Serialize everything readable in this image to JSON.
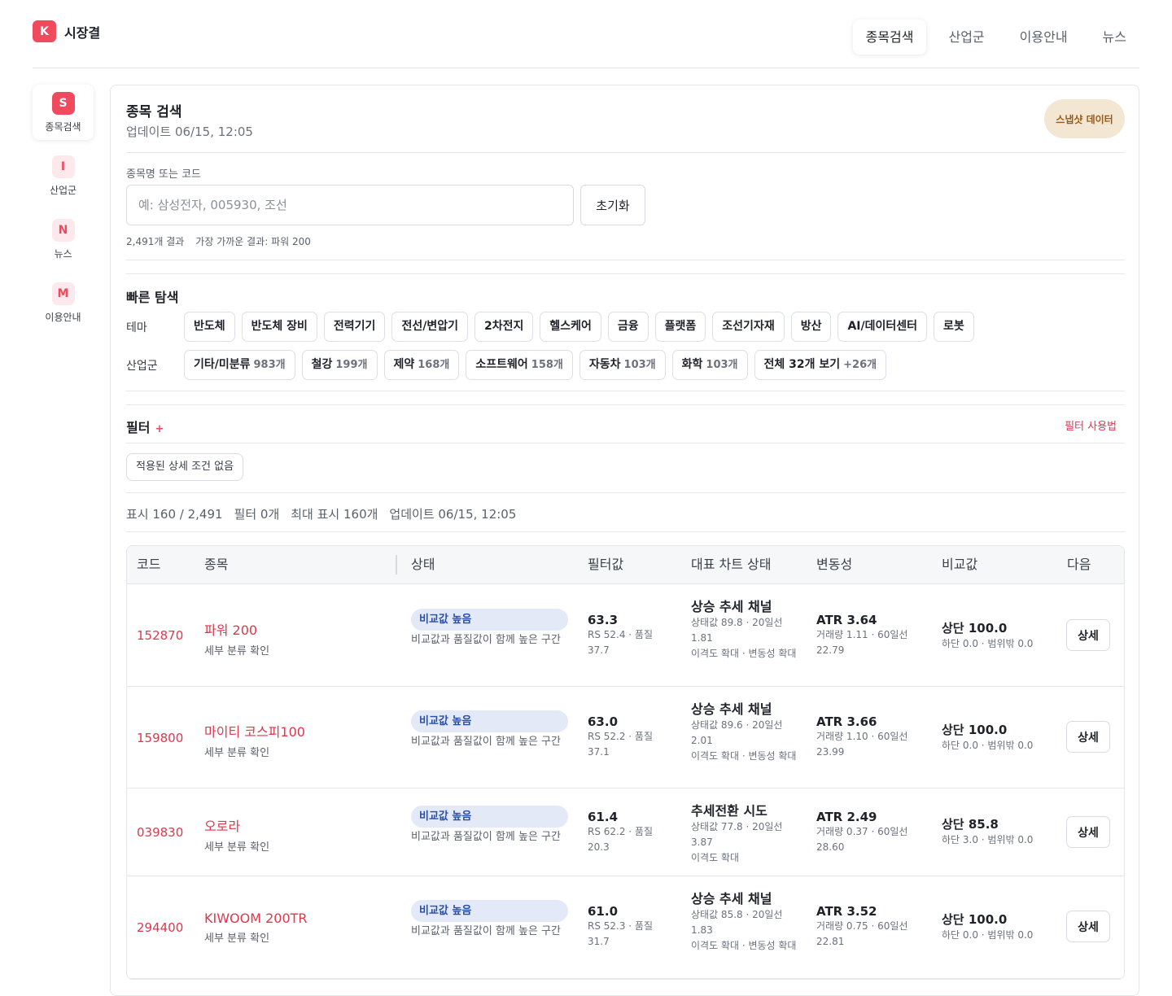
{
  "brand": {
    "logo_letter": "K",
    "name": "시장결"
  },
  "topnav": [
    "종목검색",
    "산업군",
    "이용안내",
    "뉴스"
  ],
  "sidenav": [
    {
      "letter": "S",
      "label": "종목검색"
    },
    {
      "letter": "I",
      "label": "산업군"
    },
    {
      "letter": "N",
      "label": "뉴스"
    },
    {
      "letter": "M",
      "label": "이용안내"
    }
  ],
  "search": {
    "title": "종목 검색",
    "updated": "업데이트 06/15, 12:05",
    "snapshot": "스냅샷 데이터",
    "field_label": "종목명 또는 코드",
    "placeholder": "예: 삼성전자, 005930, 조선",
    "reset": "초기화",
    "result_count": "2,491개 결과",
    "closest": "가장 가까운 결과: 파워 200"
  },
  "quick": {
    "title": "빠른 탐색",
    "theme_label": "테마",
    "themes": [
      "반도체",
      "반도체 장비",
      "전력기기",
      "전선/변압기",
      "2차전지",
      "헬스케어",
      "금융",
      "플랫폼",
      "조선기자재",
      "방산",
      "AI/데이터센터",
      "로봇"
    ],
    "industry_label": "산업군",
    "industries": [
      {
        "name": "기타/미분류",
        "count": "983개"
      },
      {
        "name": "철강",
        "count": "199개"
      },
      {
        "name": "제약",
        "count": "168개"
      },
      {
        "name": "소프트웨어",
        "count": "158개"
      },
      {
        "name": "자동차",
        "count": "103개"
      },
      {
        "name": "화학",
        "count": "103개"
      },
      {
        "name": "전체 32개 보기",
        "count": "+26개"
      }
    ]
  },
  "filter": {
    "title": "필터",
    "plus": "+",
    "help": "필터 사용법",
    "no_condition": "적용된 상세 조건 없음"
  },
  "summary": [
    "표시 160 / 2,491",
    "필터 0개",
    "최대 표시 160개",
    "업데이트 06/15, 12:05"
  ],
  "table": {
    "headers": [
      "코드",
      "종목",
      "상태",
      "필터값",
      "대표 차트 상태",
      "변동성",
      "비교값",
      "다음"
    ],
    "rows": [
      {
        "code": "152870",
        "name": "파워 200",
        "sub": "세부 분류 확인",
        "badge": "비교값 높음",
        "desc": "비교값과 품질값이 함께 높은 구간",
        "filter": "63.3",
        "filter_sub": "RS 52.4 · 품질 37.7",
        "chart": "상승 추세 채널",
        "chart_sub1": "상태값 89.8 · 20일선 1.81",
        "chart_sub2": "이격도 확대 · 변동성 확대",
        "atr": "ATR 3.64",
        "atr_sub": "거래량 1.11 · 60일선 22.79",
        "cmp": "상단 100.0",
        "cmp_sub": "하단 0.0 · 범위밖 0.0",
        "btn": "상세"
      },
      {
        "code": "159800",
        "name": "마이티 코스피100",
        "sub": "세부 분류 확인",
        "badge": "비교값 높음",
        "desc": "비교값과 품질값이 함께 높은 구간",
        "filter": "63.0",
        "filter_sub": "RS 52.2 · 품질 37.1",
        "chart": "상승 추세 채널",
        "chart_sub1": "상태값 89.6 · 20일선 2.01",
        "chart_sub2": "이격도 확대 · 변동성 확대",
        "atr": "ATR 3.66",
        "atr_sub": "거래량 1.10 · 60일선 23.99",
        "cmp": "상단 100.0",
        "cmp_sub": "하단 0.0 · 범위밖 0.0",
        "btn": "상세"
      },
      {
        "code": "039830",
        "name": "오로라",
        "sub": "세부 분류 확인",
        "badge": "비교값 높음",
        "desc": "비교값과 품질값이 함께 높은 구간",
        "filter": "61.4",
        "filter_sub": "RS 62.2 · 품질 20.3",
        "chart": "추세전환 시도",
        "chart_sub1": "상태값 77.8 · 20일선 3.87",
        "chart_sub2": "이격도 확대",
        "atr": "ATR 2.49",
        "atr_sub": "거래량 0.37 · 60일선 28.60",
        "cmp": "상단 85.8",
        "cmp_sub": "하단 3.0 · 범위밖 0.0",
        "btn": "상세"
      },
      {
        "code": "294400",
        "name": "KIWOOM 200TR",
        "sub": "세부 분류 확인",
        "badge": "비교값 높음",
        "desc": "비교값과 품질값이 함께 높은 구간",
        "filter": "61.0",
        "filter_sub": "RS 52.3 · 품질 31.7",
        "chart": "상승 추세 채널",
        "chart_sub1": "상태값 85.8 · 20일선 1.83",
        "chart_sub2": "이격도 확대 · 변동성 확대",
        "atr": "ATR 3.52",
        "atr_sub": "거래량 0.75 · 60일선 22.81",
        "cmp": "상단 100.0",
        "cmp_sub": "하단 0.0 · 범위밖 0.0",
        "btn": "상세"
      }
    ]
  }
}
